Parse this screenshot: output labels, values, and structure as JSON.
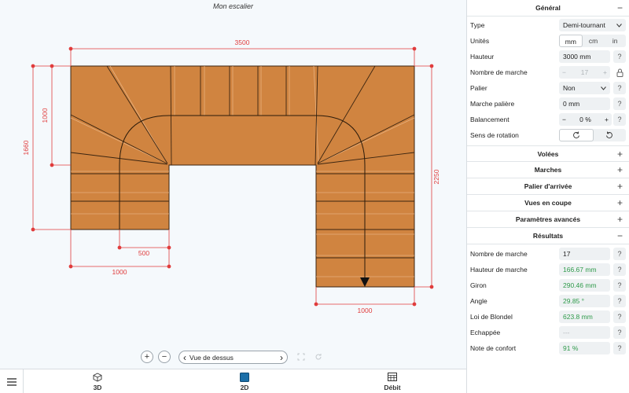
{
  "canvas": {
    "title": "Mon escalier",
    "dimensions": {
      "top_width": "3500",
      "left_total": "1660",
      "left_inner": "1000",
      "right_height": "2250",
      "bottom_left_inner": "500",
      "bottom_left_outer": "1000",
      "bottom_right": "1000"
    }
  },
  "controls": {
    "zoom_in": "+",
    "zoom_out": "−",
    "view_prev": "‹",
    "view_label": "Vue de dessus",
    "view_next": "›"
  },
  "bottom_tabs": [
    {
      "label": "3D",
      "icon": "cube-icon"
    },
    {
      "label": "2D",
      "icon": "square-icon"
    },
    {
      "label": "Débit",
      "icon": "table-icon"
    }
  ],
  "panel": {
    "general": {
      "title": "Général",
      "sign": "−",
      "type_label": "Type",
      "type_value": "Demi-tournant",
      "units_label": "Unités",
      "units": [
        "mm",
        "cm",
        "in"
      ],
      "height_label": "Hauteur",
      "height_value": "3000 mm",
      "steps_label": "Nombre de marche",
      "steps_minus": "−",
      "steps_value": "17",
      "steps_plus": "+",
      "landing_label": "Palier",
      "landing_value": "Non",
      "landing_step_label": "Marche palière",
      "landing_step_value": "0 mm",
      "balance_label": "Balancement",
      "balance_minus": "−",
      "balance_value": "0 %",
      "balance_plus": "+",
      "rotation_label": "Sens de rotation"
    },
    "collapsed_sections": [
      {
        "title": "Volées",
        "sign": "+"
      },
      {
        "title": "Marches",
        "sign": "+"
      },
      {
        "title": "Palier d'arrivée",
        "sign": "+"
      },
      {
        "title": "Vues en coupe",
        "sign": "+"
      },
      {
        "title": "Paramètres avancés",
        "sign": "+"
      }
    ],
    "results": {
      "title": "Résultats",
      "sign": "−",
      "rows": [
        {
          "label": "Nombre de marche",
          "value": "17",
          "style": "normal"
        },
        {
          "label": "Hauteur de marche",
          "value": "166.67 mm",
          "style": "green"
        },
        {
          "label": "Giron",
          "value": "290.46 mm",
          "style": "green"
        },
        {
          "label": "Angle",
          "value": "29.85 °",
          "style": "green"
        },
        {
          "label": "Loi de Blondel",
          "value": "623.8 mm",
          "style": "green"
        },
        {
          "label": "Echappée",
          "value": "---",
          "style": "dim"
        },
        {
          "label": "Note de confort",
          "value": "91 %",
          "style": "green"
        }
      ]
    },
    "help": "?"
  },
  "colors": {
    "stair_fill": "#d08440",
    "stair_line": "#5a3412",
    "dimension": "#e03c3c",
    "selected_tab": "#1c6fa8"
  }
}
